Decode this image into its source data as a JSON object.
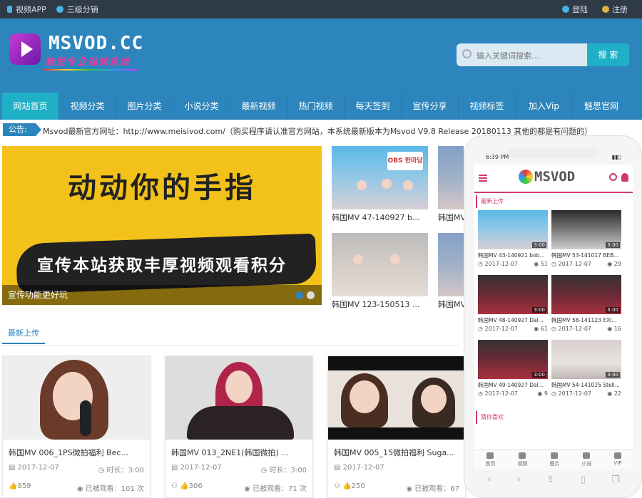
{
  "topbar": {
    "left": [
      "视频APP",
      "三级分销"
    ],
    "right": [
      "登陆",
      "注册"
    ]
  },
  "header": {
    "logo_title": "MSVOD.CC",
    "logo_subtitle": "魅思专业视频系统",
    "search_placeholder": "输入关键词搜索...",
    "search_button": "搜 索"
  },
  "nav": [
    "网站首页",
    "视频分类",
    "图片分类",
    "小说分类",
    "最新视频",
    "热门视频",
    "每天签到",
    "宣传分享",
    "视频标签",
    "加入Vip",
    "魅思官网"
  ],
  "notice": {
    "label": "公告:",
    "text": "Msvod最新官方网址：http://www.meisivod.com/（购买程序请认准官方网站，本系统最新版本为Msvod V9.8 Release 20180113 其他的都是有问题的）"
  },
  "banner": {
    "line1": "动动你的手指",
    "line2": "宣传本站获取丰厚视频观看积分",
    "caption": "宣传功能更好玩"
  },
  "side_videos": [
    {
      "title": "韩国MV 47-140927 b..."
    },
    {
      "title": "韩国MV"
    },
    {
      "title": "韩国MV 123-150513 ..."
    },
    {
      "title": "韩国MV"
    }
  ],
  "thumb_text": "OBS 한마당",
  "section": {
    "latest": "最新上传"
  },
  "cards": [
    {
      "title": "韩国MV 006_1PS微拍福利 Bec...",
      "date": "2017-12-07",
      "duration_label": "时长：",
      "duration": "3:00",
      "likes": "859",
      "views_label": "已被观看：",
      "views": "101 次"
    },
    {
      "title": "韩国MV 013_2NE1(韩国微拍) ...",
      "date": "2017-12-07",
      "duration_label": "时长：",
      "duration": "3:00",
      "likes": "306",
      "views_label": "已被观看：",
      "views": "71 次"
    },
    {
      "title": "韩国MV 005_15微拍福利 Suga...",
      "date": "2017-12-07",
      "duration_label": "时长：",
      "duration": "3:00",
      "likes": "250",
      "views_label": "已被观看：",
      "views": "67"
    }
  ],
  "phone": {
    "time": "6:39 PM",
    "logo": "MSVOD",
    "section_latest": "最新上传",
    "section_like": "猜你喜欢",
    "videos": [
      {
        "title": "韩国MV 43-140921 bob...",
        "date": "2017-12-07",
        "views": "51",
        "duration": "3:00"
      },
      {
        "title": "韩国MV 53-141017 BEB...",
        "date": "2017-12-07",
        "views": "29",
        "duration": "3:00"
      },
      {
        "title": "韩国MV 48-140927 Dal...",
        "date": "2017-12-07",
        "views": "61",
        "duration": "3:00"
      },
      {
        "title": "韩国MV 58-141123 EXI...",
        "date": "2017-12-07",
        "views": "16",
        "duration": "3:00"
      },
      {
        "title": "韩国MV 49-140927 Dal...",
        "date": "2017-12-07",
        "views": "9",
        "duration": "3:00"
      },
      {
        "title": "韩国MV 54-141025 Stell...",
        "date": "2017-12-07",
        "views": "22",
        "duration": "3:00"
      }
    ],
    "tabbar": [
      "首页",
      "视频",
      "图片",
      "小说",
      "VIP"
    ]
  },
  "colors": {
    "accent": "#2c86bd",
    "nav_active": "#1fb0c8",
    "mobile_accent": "#d03a6a"
  }
}
